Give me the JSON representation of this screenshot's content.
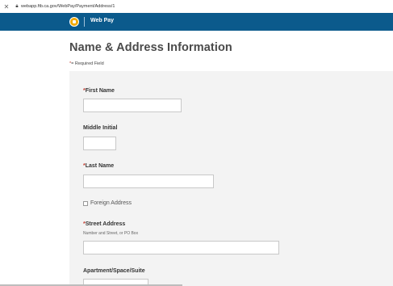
{
  "browser": {
    "url": "webapp.ftb.ca.gov/WebPay/Payment/Address/1"
  },
  "header": {
    "title": "Web Pay",
    "brand_color": "#0b5a8c",
    "logo_color": "#f2a900"
  },
  "page": {
    "title": "Name & Address Information",
    "required_star": "*",
    "required_note": "= Required Field"
  },
  "form": {
    "first_name": {
      "star": "*",
      "label": "First Name",
      "value": ""
    },
    "middle_initial": {
      "label": "Middle Initial",
      "value": ""
    },
    "last_name": {
      "star": "*",
      "label": "Last Name",
      "value": ""
    },
    "foreign_address": {
      "label": "Foreign Address",
      "checked": false
    },
    "street_address": {
      "star": "*",
      "label": "Street Address",
      "hint": "Number and Street, or PO Box",
      "value": ""
    },
    "apartment": {
      "label": "Apartment/Space/Suite",
      "value": ""
    }
  }
}
